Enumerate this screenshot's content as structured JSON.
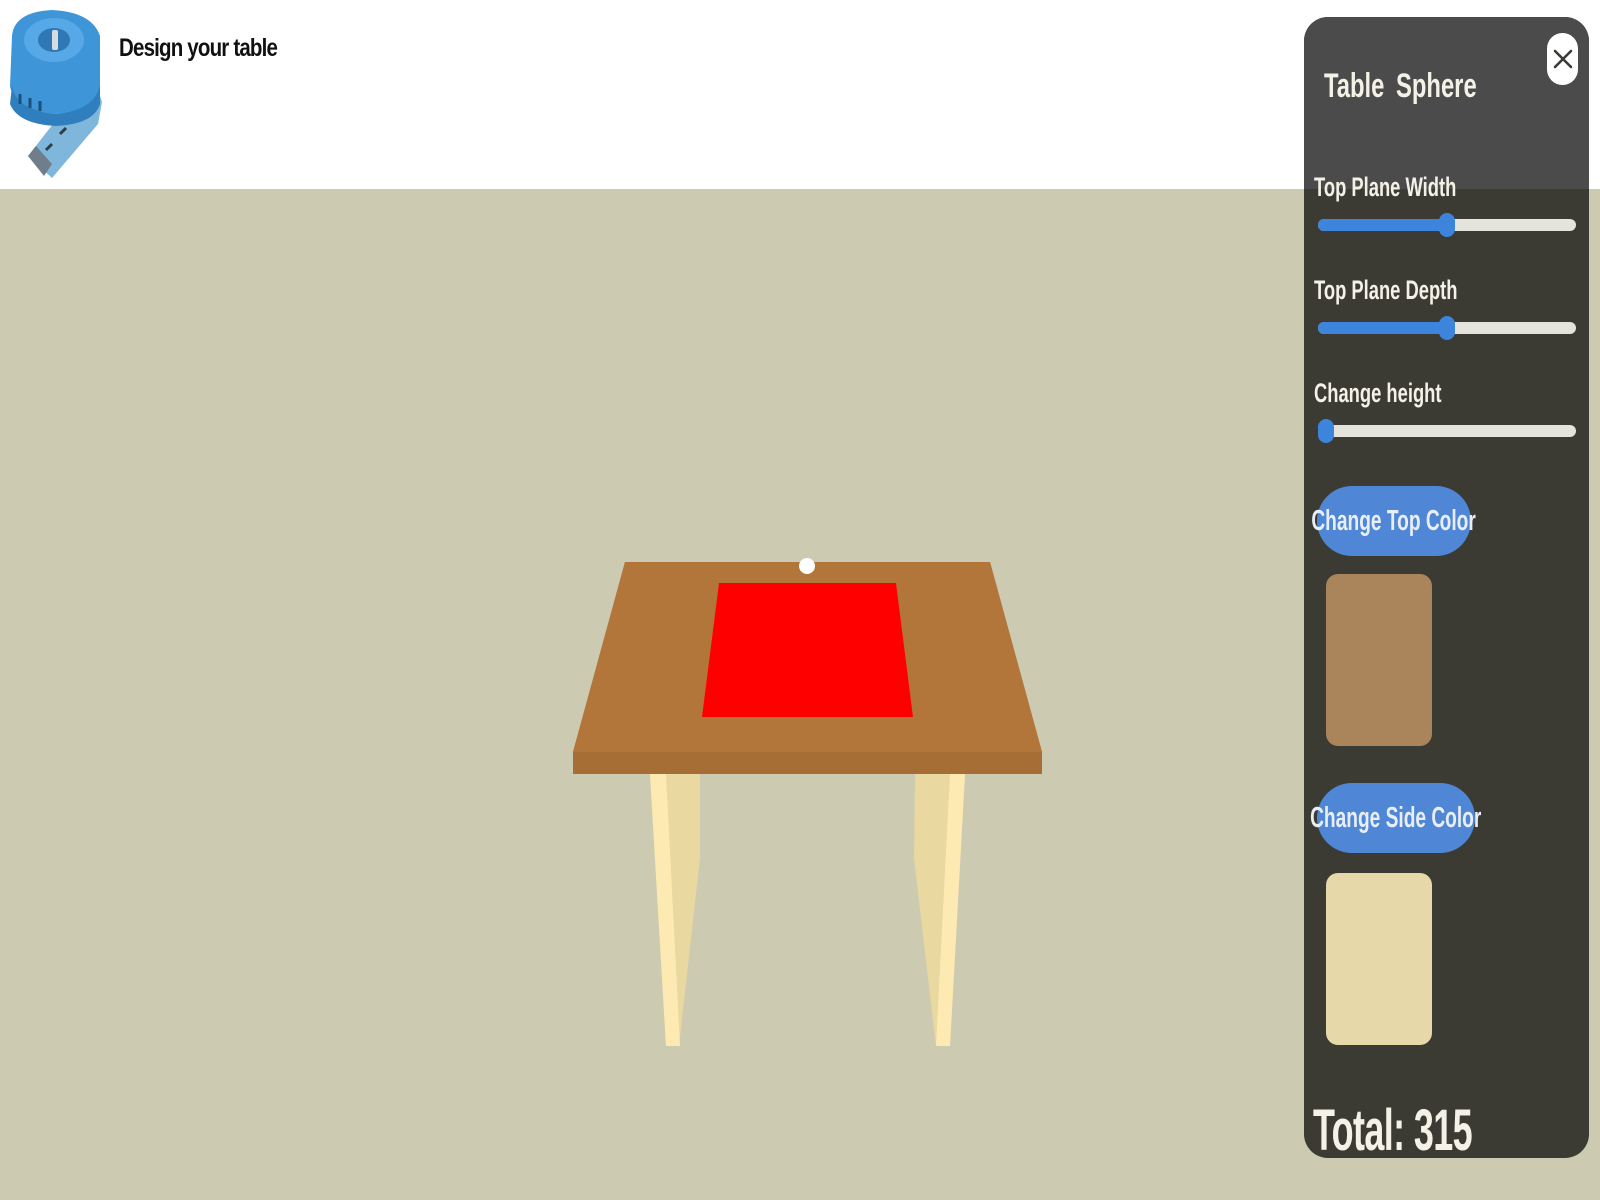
{
  "header": {
    "title": "Design your table",
    "logo_icon": "tape-measure-icon"
  },
  "scene": {
    "background_color": "#cccbb1",
    "table_top_color": "#b2763a",
    "table_edge_color": "#a66d34",
    "inlay_color": "#ff0000",
    "leg_light_color": "#fdeab3",
    "leg_shade_color": "#e9d89f",
    "sphere_color": "#ffffff"
  },
  "panel": {
    "tabs": [
      {
        "label": "Table"
      },
      {
        "label": "Sphere"
      }
    ],
    "close_icon": "close-icon",
    "sliders": [
      {
        "label": "Top Plane Width",
        "value_fraction": 0.5
      },
      {
        "label": "Top Plane Depth",
        "value_fraction": 0.5
      },
      {
        "label": "Change height",
        "value_fraction": 0.0
      }
    ],
    "top_color_button": "Change Top Color",
    "top_color_swatch": "#aa845a",
    "side_color_button": "Change Side Color",
    "side_color_swatch": "#e6d8a8",
    "total": "Total: 315"
  },
  "colors": {
    "accent": "#3d85dc",
    "panel_background": "#3b3a33",
    "panel_header": "#4b4b4b",
    "button": "#4f87d6"
  }
}
